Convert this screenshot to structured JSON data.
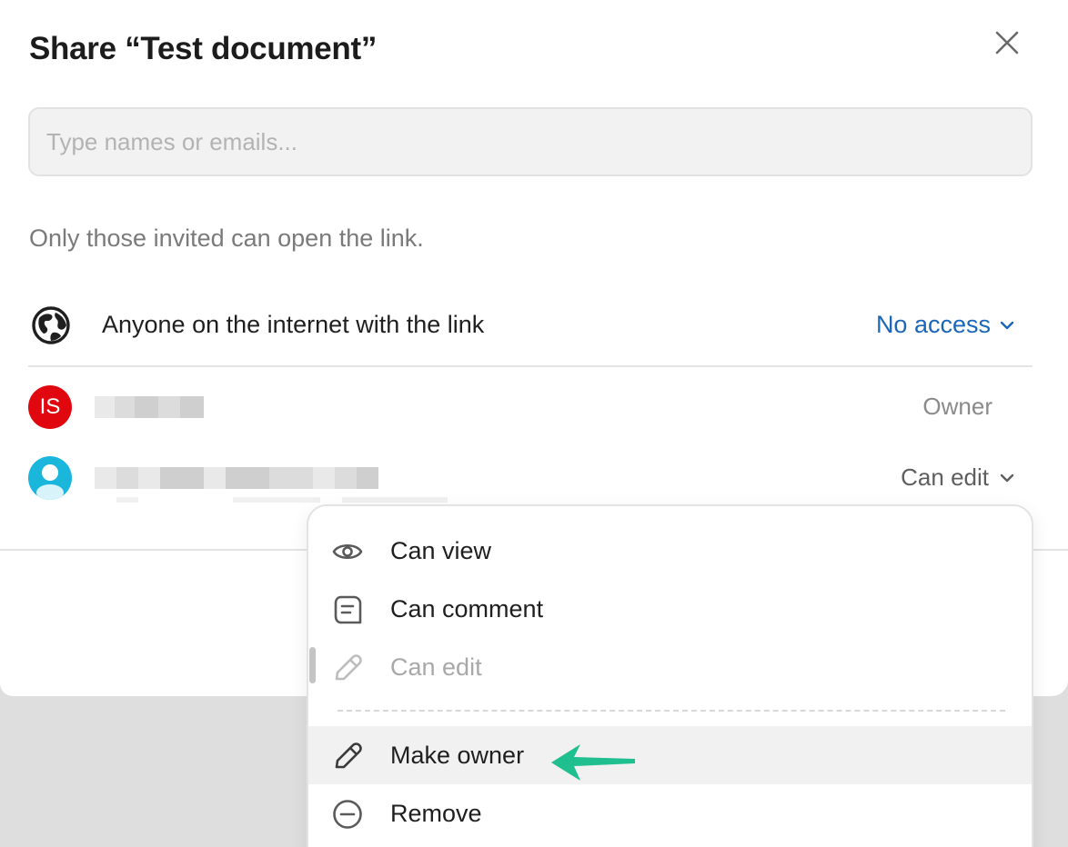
{
  "dialog": {
    "title": "Share “Test document”",
    "search_placeholder": "Type names or emails...",
    "note": "Only those invited can open the link."
  },
  "link_access": {
    "label": "Anyone on the internet with the link",
    "value": "No access",
    "icon": "globe-icon"
  },
  "people": [
    {
      "initials": "IS",
      "avatar_color": "#e0080e",
      "role": "Owner"
    },
    {
      "avatar_color": "#1ab6dc",
      "role": "Can edit"
    }
  ],
  "permission_menu": {
    "items": [
      {
        "label": "Can view",
        "icon": "eye-icon"
      },
      {
        "label": "Can comment",
        "icon": "comment-icon"
      },
      {
        "label": "Can edit",
        "icon": "pencil-icon",
        "disabled": true
      },
      {
        "label": "Make owner",
        "icon": "pencil-icon",
        "highlighted": true
      },
      {
        "label": "Remove",
        "icon": "minus-circle-icon"
      }
    ]
  },
  "colors": {
    "link_accent": "#1a66b8",
    "arrow_annotation": "#1fbf8f",
    "owner_avatar": "#e0080e",
    "editor_avatar": "#1ab6dc"
  }
}
